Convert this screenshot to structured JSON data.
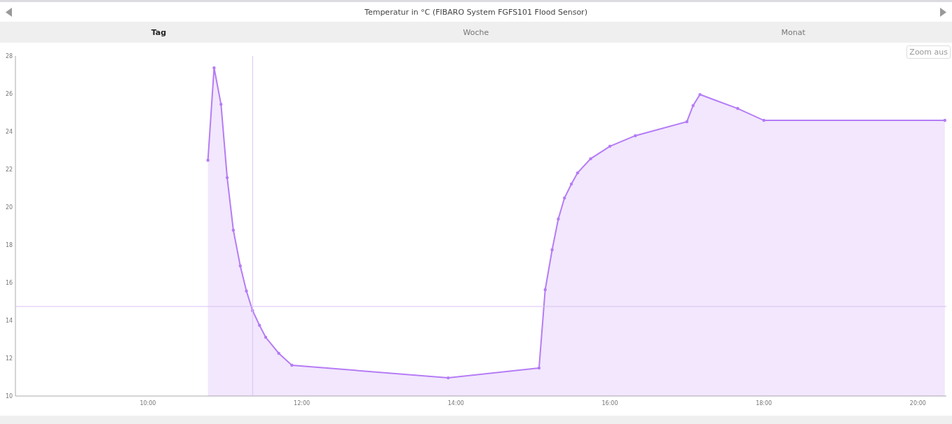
{
  "header": {
    "title": "Temperatur in °C (FIBARO System FGFS101 Flood Sensor)"
  },
  "tabs": [
    {
      "label": "Tag",
      "selected": true
    },
    {
      "label": "Woche",
      "selected": false
    },
    {
      "label": "Monat",
      "selected": false
    }
  ],
  "zoom_button": {
    "label": "Zoom aus"
  },
  "chart": {
    "chart_data": {
      "type": "area",
      "x": [
        10.78,
        10.86,
        10.95,
        11.03,
        11.11,
        11.2,
        11.28,
        11.36,
        11.45,
        11.53,
        11.7,
        11.87,
        13.9,
        15.08,
        15.16,
        15.25,
        15.33,
        15.41,
        15.5,
        15.58,
        15.75,
        16.0,
        16.33,
        17.0,
        17.08,
        17.17,
        17.66,
        18.0,
        20.35
      ],
      "series": [
        {
          "color": "#b57cf5",
          "values": [
            22.48,
            27.37,
            25.44,
            21.56,
            18.78,
            16.89,
            15.56,
            14.52,
            13.74,
            13.11,
            12.26,
            11.63,
            10.96,
            11.48,
            15.63,
            17.74,
            19.37,
            20.48,
            21.22,
            21.81,
            22.56,
            23.22,
            23.78,
            24.52,
            25.37,
            25.96,
            25.22,
            24.59,
            24.59
          ]
        }
      ],
      "xlim": [
        8.28,
        20.37
      ],
      "ylim": [
        10,
        28
      ],
      "xticks": [
        {
          "value": 10,
          "label": "10:00"
        },
        {
          "value": 12,
          "label": "12:00"
        },
        {
          "value": 14,
          "label": "14:00"
        },
        {
          "value": 16,
          "label": "16:00"
        },
        {
          "value": 18,
          "label": "18:00"
        },
        {
          "value": 20,
          "label": "20:00"
        }
      ],
      "yticks": [
        10,
        12,
        14,
        16,
        18,
        20,
        22,
        24,
        26,
        28
      ],
      "ref_lines": [
        {
          "axis": "x",
          "value": 11.36
        },
        {
          "axis": "y",
          "value": 14.74
        }
      ]
    }
  }
}
